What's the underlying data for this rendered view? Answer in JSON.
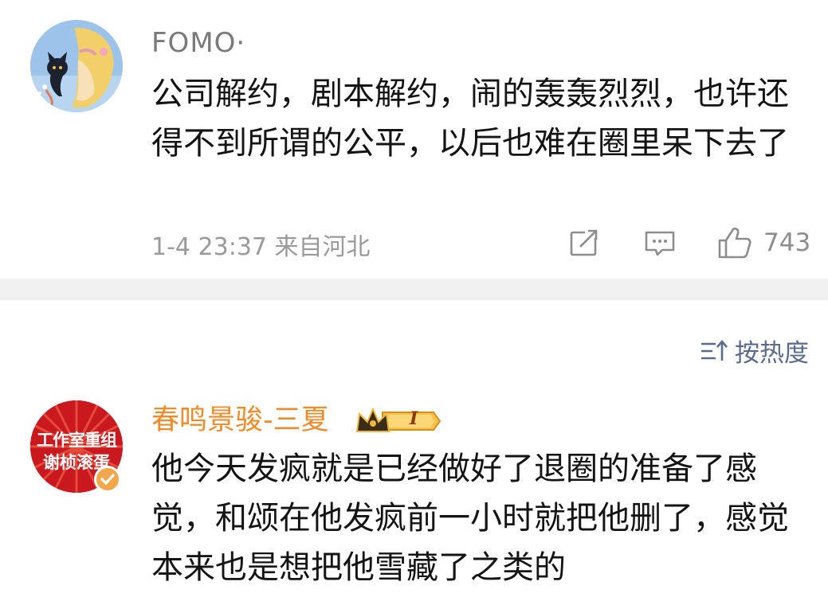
{
  "comments": [
    {
      "username": "FOMO·",
      "text": "公司解约，剧本解约，闹的轰轰烈烈，也许还得不到所谓的公平，以后也难在圈里呆下去了",
      "timestamp": "1-4 23:37 来自河北",
      "like_count": "743",
      "icons": [
        "share-icon",
        "comment-icon",
        "like-icon"
      ]
    },
    {
      "username": "春鸣景骏-三夏",
      "user_color": "#f08b2b",
      "avatar_text_line1": "工作室重组",
      "avatar_text_line2": "谢桢滚蛋",
      "level_badge": "I",
      "text": "他今天发疯就是已经做好了退圈的准备了感觉，和颂在他发疯前一小时就把他删了，感觉本来也是想把他雪藏了之类的"
    }
  ],
  "sort": {
    "label": "按热度"
  },
  "colors": {
    "meta": "#9a9a9a",
    "sort": "#5b6b8c",
    "divider": "#f1f1f1",
    "highlight_name": "#f08b2b"
  }
}
